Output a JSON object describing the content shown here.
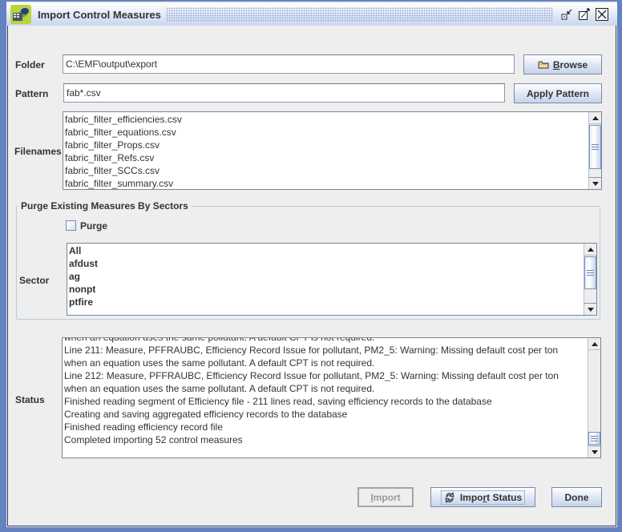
{
  "window": {
    "title": "Import Control Measures",
    "controls": [
      "minimize",
      "maximize",
      "close"
    ]
  },
  "form": {
    "folder_label": "Folder",
    "folder_value": "C:\\EMF\\output\\export",
    "browse_label": "Browse",
    "browse_mnemonic": "B",
    "pattern_label": "Pattern",
    "pattern_value": "fab*.csv",
    "apply_pattern_label": "Apply Pattern",
    "filenames_label": "Filenames",
    "filenames": [
      "fabric_filter_efficiencies.csv",
      "fabric_filter_equations.csv",
      "fabric_filter_Props.csv",
      "fabric_filter_Refs.csv",
      "fabric_filter_SCCs.csv",
      "fabric_filter_summary.csv"
    ]
  },
  "purge": {
    "group_title": "Purge Existing Measures By Sectors",
    "checkbox_label": "Purge",
    "checked": false,
    "sector_label": "Sector",
    "sectors": [
      "All",
      "afdust",
      "ag",
      "nonpt",
      "ptfire"
    ]
  },
  "status": {
    "label": "Status",
    "partial_top_line": "when an equation uses the same pollutant.  A default CPT is not required.",
    "lines": [
      "Line 211: Measure, PFFRAUBC, Efficiency Record Issue for pollutant, PM2_5: Warning: Missing default cost per ton",
      "when an equation uses the same pollutant.  A default CPT is not required.",
      "Line 212: Measure, PFFRAUBC, Efficiency Record Issue for pollutant, PM2_5: Warning: Missing default cost per ton",
      "when an equation uses the same pollutant.  A default CPT is not required.",
      "Finished reading segment of Efficiency file - 211 lines read, saving efficiency records to the database",
      "Creating and saving aggregated efficiency records to the database",
      "Finished reading efficiency record file",
      "Completed importing 52 control measures"
    ]
  },
  "buttons": {
    "import_label": "Import",
    "import_enabled": false,
    "import_status_label": "Import Status",
    "done_label": "Done"
  },
  "icons": {
    "app": "emf-app-icon",
    "browse": "folder-icon",
    "import_status": "refresh-icon"
  }
}
